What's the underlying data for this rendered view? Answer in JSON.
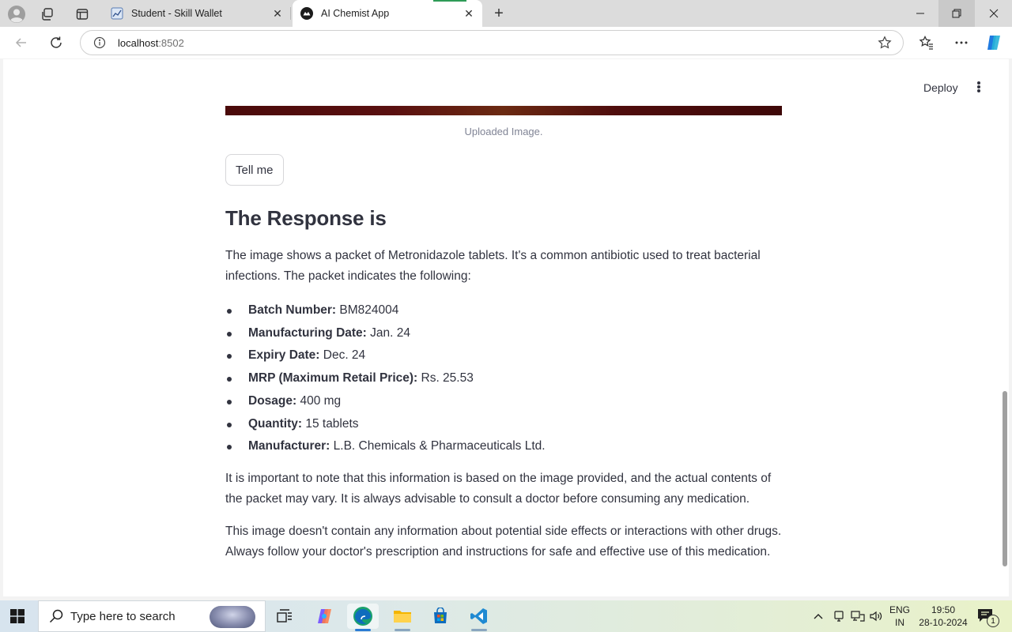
{
  "browser": {
    "tabs": [
      {
        "title": "Student - Skill Wallet",
        "active": false
      },
      {
        "title": "AI Chemist App",
        "active": true
      }
    ],
    "url_host": "localhost",
    "url_port": ":8502"
  },
  "app": {
    "deploy_label": "Deploy",
    "image_caption": "Uploaded Image.",
    "button_label": "Tell me",
    "heading": "The Response is",
    "intro": "The image shows a packet of Metronidazole tablets. It's a common antibiotic used to treat bacterial infections. The packet indicates the following:",
    "details": [
      {
        "label": "Batch Number:",
        "value": " BM824004"
      },
      {
        "label": "Manufacturing Date:",
        "value": " Jan. 24"
      },
      {
        "label": "Expiry Date:",
        "value": " Dec. 24"
      },
      {
        "label": "MRP (Maximum Retail Price):",
        "value": " Rs. 25.53"
      },
      {
        "label": "Dosage:",
        "value": " 400 mg"
      },
      {
        "label": "Quantity:",
        "value": " 15 tablets"
      },
      {
        "label": "Manufacturer:",
        "value": " L.B. Chemicals & Pharmaceuticals Ltd."
      }
    ],
    "note": "It is important to note that this information is based on the image provided, and the actual contents of the packet may vary. It is always advisable to consult a doctor before consuming any medication.",
    "disclaimer": "This image doesn't contain any information about potential side effects or interactions with other drugs. Always follow your doctor's prescription and instructions for safe and effective use of this medication."
  },
  "taskbar": {
    "search_placeholder": "Type here to search",
    "lang_line1": "ENG",
    "lang_line2": "IN",
    "time": "19:50",
    "date": "28-10-2024",
    "notification_count": "1"
  },
  "colors": {
    "text": "#31333f",
    "caption": "#808495",
    "accent_progress": "#ff4b4b"
  }
}
